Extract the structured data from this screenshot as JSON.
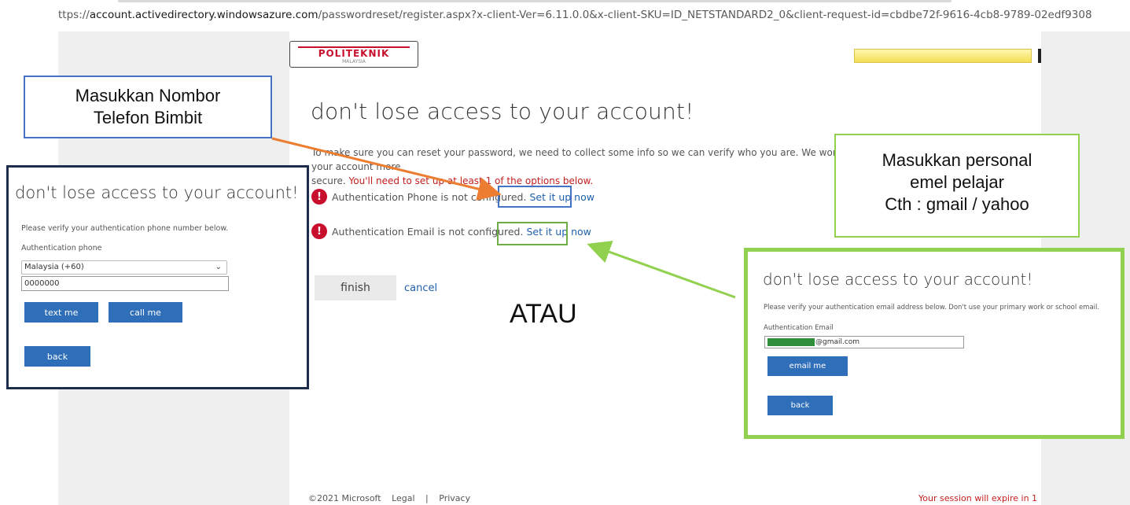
{
  "browser": {
    "url_prefix": "ttps://",
    "url_domain": "account.activedirectory.windowsazure.com",
    "url_path": "/passwordreset/register.aspx?x-client-Ver=6.11.0.0&x-client-SKU=ID_NETSTANDARD2_0&client-request-id=cbdbe72f-9616-4cb8-9789-02edf9308"
  },
  "header": {
    "logo_text": "POLITEKNIK",
    "logo_subtext": "MALAYSIA"
  },
  "main": {
    "title": "don't lose access to your account!",
    "intro": "To make sure you can reset your password, we need to collect some info so we can verify who you are. We won't use this to spam you - just to keep your account more",
    "intro2": "secure.",
    "intro_red": "You'll need to set up at least 1 of the options below.",
    "phone_status": "Authentication Phone is not configured.",
    "email_status": "Authentication Email is not configured.",
    "setup_link": "Set it up now",
    "finish": "finish",
    "cancel": "cancel"
  },
  "annotations": {
    "phone_callout_line1": "Masukkan Nombor",
    "phone_callout_line2": "Telefon Bimbit",
    "email_callout_line1": "Masukkan personal",
    "email_callout_line2": "emel pelajar",
    "email_callout_line3": "Cth : gmail / yahoo",
    "or_text": "ATAU",
    "arrow_phone_color": "#ed7d31",
    "arrow_email_color": "#92d050"
  },
  "phone_panel": {
    "title": "don't lose access to your account!",
    "instruction": "Please verify your authentication phone number below.",
    "label": "Authentication phone",
    "country": "Malaysia (+60)",
    "phone_value": "0000000",
    "text_me": "text me",
    "call_me": "call me",
    "back": "back"
  },
  "email_panel": {
    "title": "don't lose access to your account!",
    "instruction": "Please verify your authentication email address below. Don't use your primary work or school email.",
    "label": "Authentication Email",
    "email_value": "@gmail.com",
    "email_me": "email me",
    "back": "back"
  },
  "footer": {
    "copyright": "©2021 Microsoft",
    "legal": "Legal",
    "separator": "|",
    "privacy": "Privacy",
    "session": "Your session will expire in 1"
  },
  "colors": {
    "accent_blue": "#2f6eb8",
    "link_blue": "#1f5fae",
    "warning_red": "#c8102e"
  }
}
